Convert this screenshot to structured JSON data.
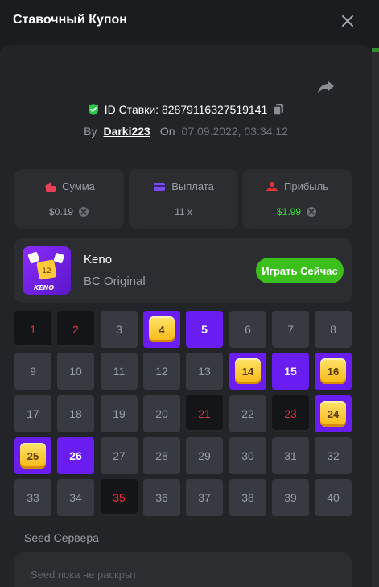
{
  "header": {
    "title": "Ставочный Купон"
  },
  "bet": {
    "id_text": "ID Ставки: 8287911632751914​1",
    "by_label": "By",
    "user": "Darki223",
    "on_label": "On",
    "date": "07.09.2022, 03:34:12"
  },
  "stats": [
    {
      "label": "Сумма",
      "value": "$0.19",
      "icon": "wallet-icon",
      "value_color": "#9a9ea5"
    },
    {
      "label": "Выплата",
      "value": "11 x",
      "icon": "card-icon",
      "value_color": "#9a9ea5"
    },
    {
      "label": "Прибыль",
      "value": "$1.99",
      "icon": "profit-icon",
      "value_color": "#3ed63e"
    }
  ],
  "game": {
    "name": "Keno",
    "subtitle": "BC Original",
    "play_label": "Играть Сейчас",
    "thumb_text": "KENO",
    "thumb_number": "12"
  },
  "grid": {
    "numbers": [
      1,
      2,
      3,
      4,
      5,
      6,
      7,
      8,
      9,
      10,
      11,
      12,
      13,
      14,
      15,
      16,
      17,
      18,
      19,
      20,
      21,
      22,
      23,
      24,
      25,
      26,
      27,
      28,
      29,
      30,
      31,
      32,
      33,
      34,
      35,
      36,
      37,
      38,
      39,
      40
    ],
    "misses": [
      1,
      2,
      21,
      23,
      35
    ],
    "picks_no_hit": [
      5,
      15,
      26
    ],
    "hits": [
      4,
      14,
      16,
      24,
      25
    ]
  },
  "seed": {
    "label": "Seed Сервера",
    "placeholder": "Seed пока не раскрыт"
  },
  "colors": {
    "accent": "#6a1df0",
    "play": "#3bbf1b",
    "miss": "#e8303b",
    "verified": "#29c94a"
  }
}
